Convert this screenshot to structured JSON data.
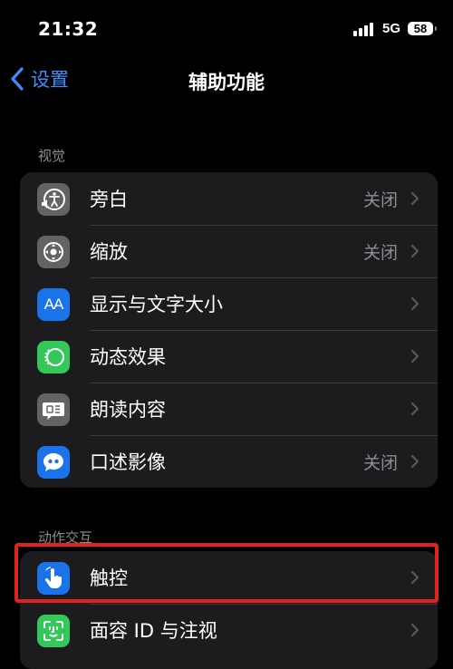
{
  "status": {
    "time": "21:32",
    "network": "5G",
    "battery": "58"
  },
  "nav": {
    "back_label": "设置",
    "title": "辅助功能"
  },
  "sections": [
    {
      "header": "视觉",
      "items": [
        {
          "label": "旁白",
          "value": "关闭",
          "icon": "voiceover-icon",
          "color": "#636366"
        },
        {
          "label": "缩放",
          "value": "关闭",
          "icon": "zoom-icon",
          "color": "#636366"
        },
        {
          "label": "显示与文字大小",
          "value": "",
          "icon": "text-size-icon",
          "color": "#1a73e8"
        },
        {
          "label": "动态效果",
          "value": "",
          "icon": "motion-icon",
          "color": "#34c759"
        },
        {
          "label": "朗读内容",
          "value": "",
          "icon": "spoken-content-icon",
          "color": "#636366"
        },
        {
          "label": "口述影像",
          "value": "关闭",
          "icon": "audio-description-icon",
          "color": "#1a73e8"
        }
      ]
    },
    {
      "header": "动作交互",
      "items": [
        {
          "label": "触控",
          "value": "",
          "icon": "hand-touch-icon",
          "color": "#1a73e8"
        },
        {
          "label": "面容 ID 与注视",
          "value": "",
          "icon": "face-id-icon",
          "color": "#34c759"
        }
      ]
    }
  ],
  "icon_text": {
    "text_size_glyph": "AA"
  }
}
